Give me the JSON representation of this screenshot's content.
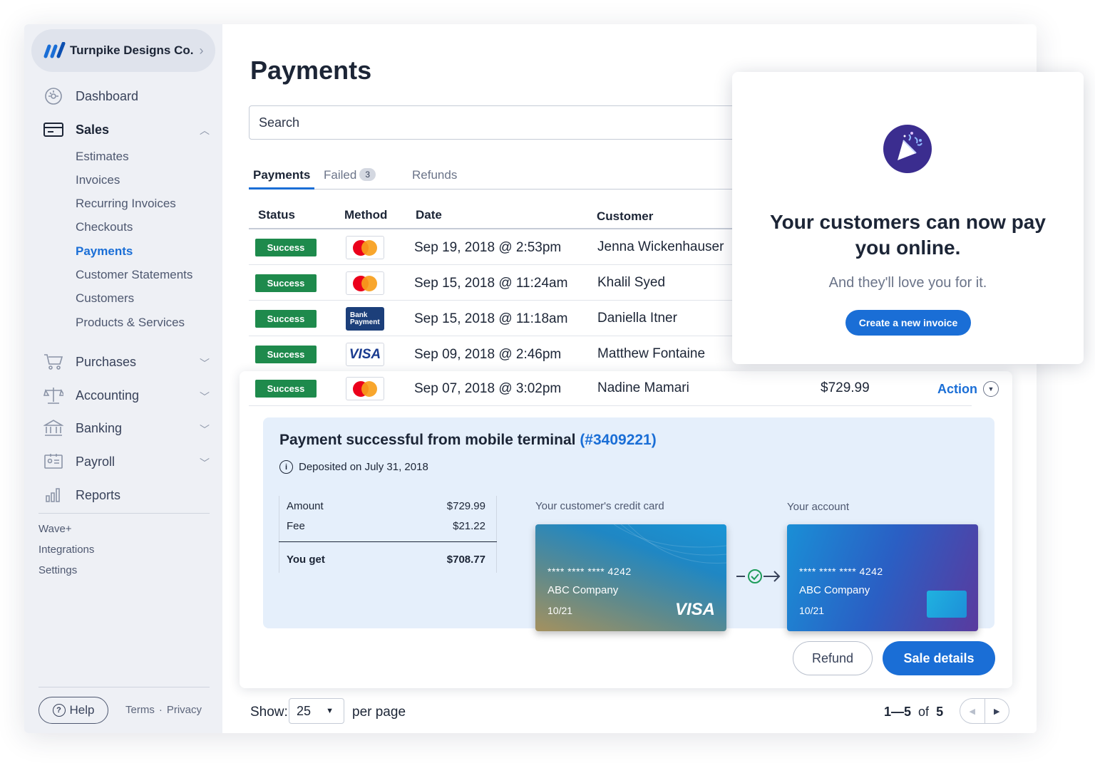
{
  "sidebar": {
    "business_name": "Turnpike Designs Co.",
    "nav": [
      {
        "label": "Dashboard",
        "icon": "dashboard-icon"
      },
      {
        "label": "Sales",
        "icon": "sales-icon"
      },
      {
        "label": "Purchases",
        "icon": "cart-icon"
      },
      {
        "label": "Accounting",
        "icon": "scale-icon"
      },
      {
        "label": "Banking",
        "icon": "bank-icon"
      },
      {
        "label": "Payroll",
        "icon": "payroll-icon"
      },
      {
        "label": "Reports",
        "icon": "reports-icon"
      }
    ],
    "sales_sub": [
      "Estimates",
      "Invoices",
      "Recurring Invoices",
      "Checkouts",
      "Payments",
      "Customer Statements",
      "Customers",
      "Products & Services"
    ],
    "active_sub": "Payments",
    "extra_links": [
      "Wave+",
      "Integrations",
      "Settings"
    ],
    "help_label": "Help",
    "terms_label": "Terms",
    "separator": "·",
    "privacy_label": "Privacy"
  },
  "main": {
    "title": "Payments",
    "search_placeholder": "Search",
    "tabs": [
      {
        "label": "Payments",
        "active": true
      },
      {
        "label": "Failed",
        "badge": "3"
      },
      {
        "label": "Refunds"
      }
    ],
    "columns": [
      "Status",
      "Method",
      "Date",
      "Customer"
    ],
    "rows": [
      {
        "status": "Success",
        "method": "mastercard",
        "date": "Sep 19, 2018 @ 2:53pm",
        "customer": "Jenna Wickenhauser"
      },
      {
        "status": "Success",
        "method": "mastercard",
        "date": "Sep 15, 2018 @ 11:24am",
        "customer": "Khalil Syed"
      },
      {
        "status": "Success",
        "method": "bank",
        "bank_label_1": "Bank",
        "bank_label_2": "Payment",
        "date": "Sep 15, 2018 @ 11:18am",
        "customer": "Daniella Itner"
      },
      {
        "status": "Success",
        "method": "visa",
        "visa_label": "VISA",
        "date": "Sep 09, 2018 @ 2:46pm",
        "customer": "Matthew Fontaine"
      },
      {
        "status": "Success",
        "method": "mastercard",
        "date": "Sep 07, 2018 @ 3:02pm",
        "customer": "Nadine Mamari",
        "amount": "$729.99",
        "action": "Action"
      }
    ],
    "detail": {
      "title": "Payment successful from mobile terminal",
      "ref": "(#3409221)",
      "deposited": "Deposited on July 31, 2018",
      "amount_label": "Amount",
      "amount": "$729.99",
      "fee_label": "Fee",
      "fee": "$21.22",
      "you_get_label": "You get",
      "you_get": "$708.77",
      "customer_card_label": "Your customer's credit card",
      "account_label": "Your account",
      "customer_card": {
        "number": "**** **** **** 4242",
        "company": "ABC Company",
        "expiry": "10/21",
        "brand": "VISA"
      },
      "account_card": {
        "number": "**** **** **** 4242",
        "company": "ABC Company",
        "expiry": "10/21"
      }
    },
    "refund_label": "Refund",
    "sale_details_label": "Sale details",
    "pager": {
      "show_label": "Show:",
      "per_page_value": "25",
      "per_page_label": "per page",
      "range": "1—5",
      "of_label": "of",
      "total": "5"
    }
  },
  "popup": {
    "title": "Your customers can now pay you online.",
    "subtitle": "And they'll love you for it.",
    "button": "Create a new invoice"
  },
  "colors": {
    "accent": "#1a6ed6",
    "success": "#1e8a4c",
    "sidebar_bg": "#eef0f5",
    "detail_bg": "#e5effb"
  }
}
